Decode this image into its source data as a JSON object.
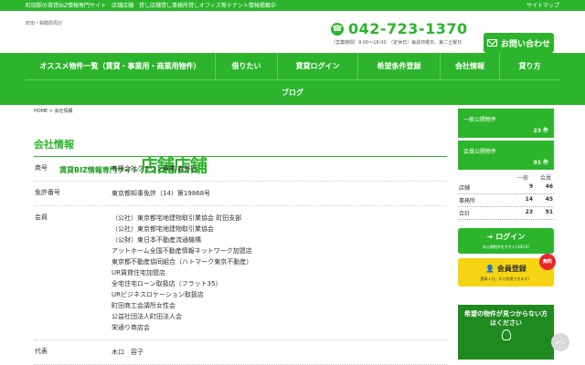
{
  "topbar": {
    "left_text": "町田駅の賃貸BIZ情報専門サイト　店舗店舗　貸し店舗貸し事務所貸しオフィス等テナント情報掲載中",
    "right_text": "サイトマップ"
  },
  "logo": {
    "small_text": "町田・相模原周辺",
    "main_text": "賃貸BIZ情報専門サイト",
    "brand": "店舗店舗"
  },
  "phone": {
    "number": "042-723-1370",
    "hours": "（営業時間）9:00～18:00　（定休日）毎週日曜日、第二土曜日"
  },
  "contact_button": "お問い合わせ",
  "nav": {
    "items": [
      "オススメ物件一覧（賃貸・事業用・商業用物件）",
      "借りたい",
      "賃貸ログイン",
      "希望条件登録",
      "会社情報",
      "貸り方"
    ],
    "blog": "ブログ"
  },
  "breadcrumb": "HOME > 会社情報",
  "page_title": "会社情報",
  "company": {
    "rows": [
      {
        "key": "商号",
        "values": [
          "有限会社クラウン興業 森野店"
        ]
      },
      {
        "key": "免許番号",
        "values": [
          "東京都知事免許（14）第19868号"
        ]
      },
      {
        "key": "会員",
        "values": [
          "（公社）東京都宅地建物取引業協会 町田支部",
          "（公社）東京都宅地建物取引業協会",
          "（公財）東日本不動産流通機構",
          "アットホーム全国不動産情報ネットワーク加盟店",
          "東京都不動産協同組合（ハトマーク東京不動産）",
          "UR賃貸住宅加盟店",
          "全宅住宅ローン取扱店（フラット35）",
          "URビジネスロケーション取扱店",
          "町田商工会議所女性会",
          "公益社団法人町田法人会",
          "栄通り商店会"
        ]
      },
      {
        "key": "代表",
        "values": [
          "木口　容子"
        ]
      }
    ]
  },
  "sidebar": {
    "public_label": "一般公開物件",
    "public_count": "23 件",
    "member_label": "会員公開物件",
    "member_count": "91 件",
    "stats_headers": [
      "一般",
      "会員"
    ],
    "stats": [
      {
        "name": "店舗",
        "general": "9",
        "member": "46"
      },
      {
        "name": "事務所",
        "general": "14",
        "member": "45"
      },
      {
        "name": "合計",
        "general": "23",
        "member": "91"
      }
    ],
    "login_label": "ログイン",
    "login_sub": "非公開物件を今すぐCHECK!",
    "register_label": "会員登録",
    "register_badge": "無料",
    "register_sub": "登録１分、すぐ利用できます！",
    "wish_text1": "希望の物件が見つからない方",
    "wish_text2": "はください"
  },
  "pagetop": "︿"
}
